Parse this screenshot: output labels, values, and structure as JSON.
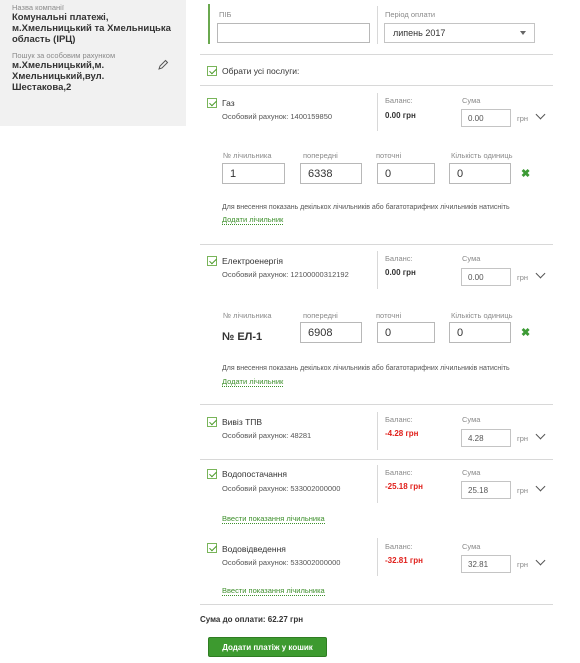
{
  "sidebar": {
    "company_label": "Назва компанії",
    "company_name": "Комунальні платежі, м.Хмельницький та Хмельницька область (ІРЦ)",
    "search_label": "Пошук за особовим рахунком",
    "search_value": "м.Хмельницький,м. Хмельницький,вул. Шестакова,2"
  },
  "header": {
    "pib_label": "ПІБ",
    "pib_value": "",
    "period_label": "Період оплати",
    "period_value": "липень 2017"
  },
  "select_all_label": "Обрати усі послуги:",
  "labels": {
    "balance": "Баланс:",
    "amount": "Сума",
    "currency": "грн",
    "meter_no": "№ лічильника",
    "previous": "попередні",
    "current": "поточні",
    "units": "Кількість одиниць",
    "multi_hint": "Для внесення показань декількох лічильників або багатотарифних лічильників натисніть",
    "add_meter": "Додати лічильник",
    "enter_readings": "Ввести показання лічильника"
  },
  "services": [
    {
      "name": "Газ",
      "account": "Особовий рахунок: 1400159850",
      "balance": "0.00 грн",
      "balance_color": "#333333",
      "amount": "0.00",
      "meter": {
        "no": "1",
        "prev": "6338",
        "cur": "0",
        "units": "0"
      }
    },
    {
      "name": "Електроенергія",
      "account": "Особовий рахунок: 12100000312192",
      "balance": "0.00 грн",
      "balance_color": "#333333",
      "amount": "0.00",
      "meter": {
        "no": "№ ЕЛ-1",
        "prev": "6908",
        "cur": "0",
        "units": "0"
      }
    },
    {
      "name": "Вивіз ТПВ",
      "account": "Особовий рахунок: 48281",
      "balance": "-4.28 грн",
      "balance_color": "#e0201b",
      "amount": "4.28"
    },
    {
      "name": "Водопостачання",
      "account": "Особовий рахунок: 533002000000",
      "balance": "-25.18 грн",
      "balance_color": "#e0201b",
      "amount": "25.18"
    },
    {
      "name": "Водовідведення",
      "account": "Особовий рахунок: 533002000000",
      "balance": "-32.81 грн",
      "balance_color": "#e0201b",
      "amount": "32.81"
    }
  ],
  "footer": {
    "total": "Сума до оплати:   62.27 грн",
    "add_to_cart": "Додати платіж у кошик"
  },
  "colors": {
    "accent_green": "#3d9a2f",
    "negative": "#e0201b"
  }
}
